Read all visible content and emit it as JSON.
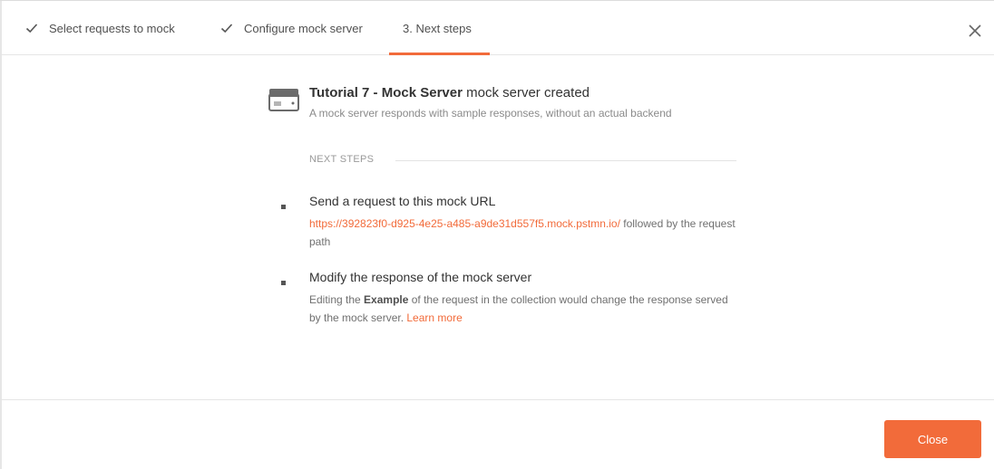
{
  "tabs": [
    {
      "label": "Select requests to mock",
      "completed": true
    },
    {
      "label": "Configure mock server",
      "completed": true
    },
    {
      "label": "3. Next steps",
      "completed": false,
      "active": true
    }
  ],
  "colors": {
    "accent": "#f26b3a",
    "text": "#333333",
    "muted": "#8a8a8a"
  },
  "icons": {
    "tab_completed": "check-icon",
    "dismiss": "close-icon",
    "server": "server-icon"
  },
  "created": {
    "server_name": "Tutorial 7 - Mock Server",
    "suffix": " mock server created",
    "description": "A mock server responds with sample responses, without an actual backend"
  },
  "next_steps": {
    "label": "NEXT STEPS",
    "items": [
      {
        "title": "Send a request to this mock URL",
        "url": "https://392823f0-d925-4e25-a485-a9de31d557f5.mock.pstmn.io/",
        "text_after_url": " followed by the request path"
      },
      {
        "title": "Modify the response of the mock server",
        "text_before": "Editing the ",
        "bold": "Example",
        "text_after": " of the request in the collection would change the response served by the mock server. ",
        "link_label": "Learn more"
      }
    ]
  },
  "footer": {
    "close_label": "Close"
  }
}
